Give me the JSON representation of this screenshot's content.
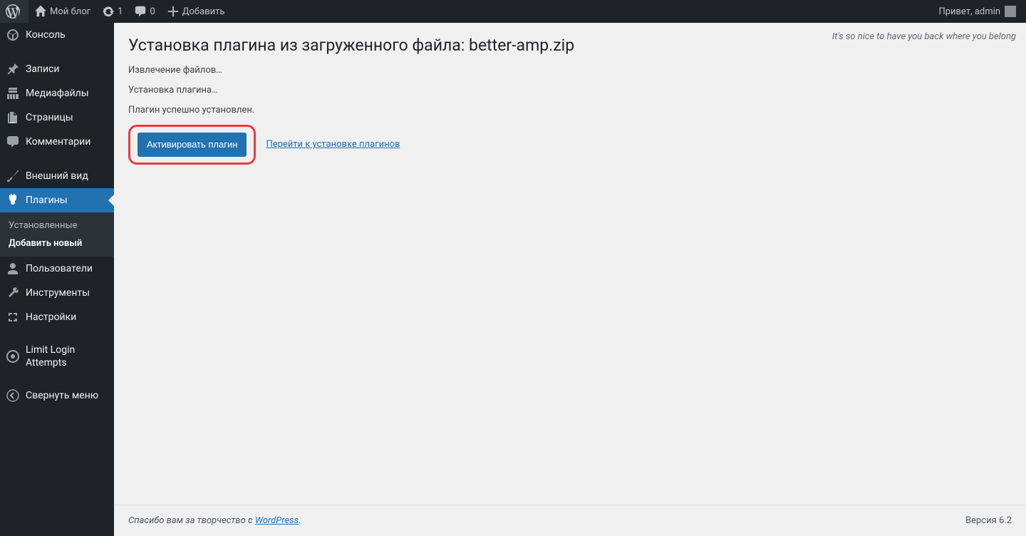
{
  "admin_bar": {
    "site_name": "Мой блог",
    "updates_count": "1",
    "comments_count": "0",
    "add_new": "Добавить",
    "greeting": "Привет, admin"
  },
  "sidebar": {
    "console": "Консоль",
    "posts": "Записи",
    "media": "Медиафайлы",
    "pages": "Страницы",
    "comments": "Комментарии",
    "appearance": "Внешний вид",
    "plugins": "Плагины",
    "plugins_sub": {
      "installed": "Установленные",
      "add_new": "Добавить новый"
    },
    "users": "Пользователи",
    "tools": "Инструменты",
    "settings": "Настройки",
    "limit_login": "Limit Login Attempts",
    "collapse": "Свернуть меню"
  },
  "content": {
    "top_note": "It's so nice to have you back where you belong",
    "heading": "Установка плагина из загруженного файла: better-amp.zip",
    "msg_extracting": "Извлечение файлов…",
    "msg_installing": "Установка плагина…",
    "msg_success": "Плагин успешно установлен.",
    "activate_btn": "Активировать плагин",
    "goto_installer": "Перейти к установке плагинов"
  },
  "footer": {
    "thanks_prefix": "Спасибо вам за творчество с ",
    "wordpress": "WordPress",
    "thanks_suffix": ".",
    "version": "Версия 6.2"
  }
}
